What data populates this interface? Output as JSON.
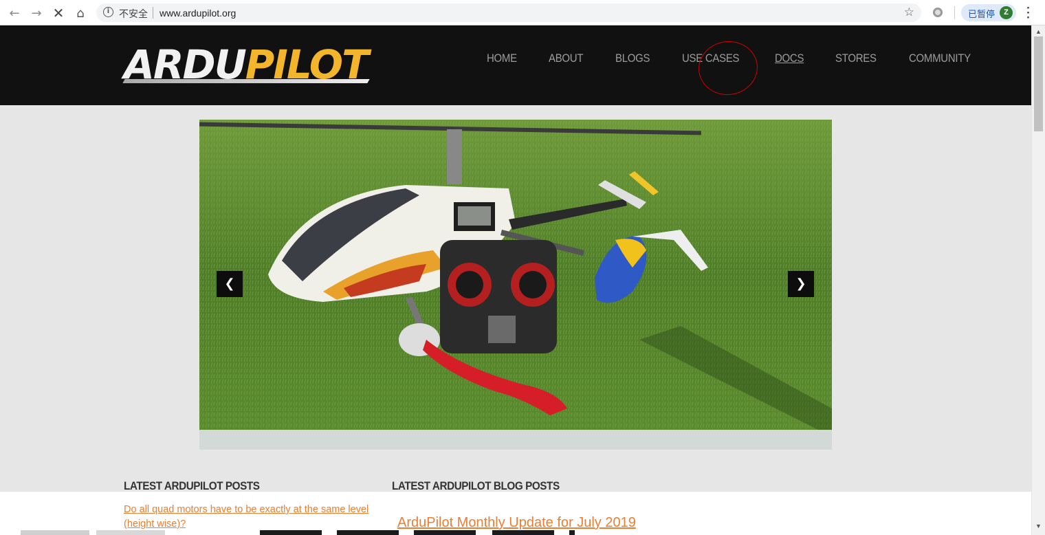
{
  "browser": {
    "security_label": "不安全",
    "url": "www.ardupilot.org",
    "profile_label": "已暂停",
    "avatar_initial": "Z"
  },
  "site": {
    "logo_part1": "ARDU",
    "logo_part2": "PILOT",
    "nav": [
      {
        "label": "HOME"
      },
      {
        "label": "ABOUT"
      },
      {
        "label": "BLOGS"
      },
      {
        "label": "USE CASES"
      },
      {
        "label": "DOCS"
      },
      {
        "label": "STORES"
      },
      {
        "label": "COMMUNITY"
      }
    ]
  },
  "carousel": {
    "prev_icon": "chevron-left-icon",
    "next_icon": "chevron-right-icon"
  },
  "sections": {
    "posts_title": "LATEST ARDUPILOT POSTS",
    "blog_title": "LATEST ARDUPILOT BLOG POSTS",
    "latest_post": "Do all quad motors have to be exactly at the same level (height wise)?",
    "latest_blog": "ArduPilot Monthly Update for July 2019"
  },
  "colors": {
    "header_bg": "#111111",
    "nav_text": "#9d9d9d",
    "logo_yellow": "#f3b52c",
    "link_orange": "#ed7d31",
    "annotation_red": "#d10000"
  }
}
